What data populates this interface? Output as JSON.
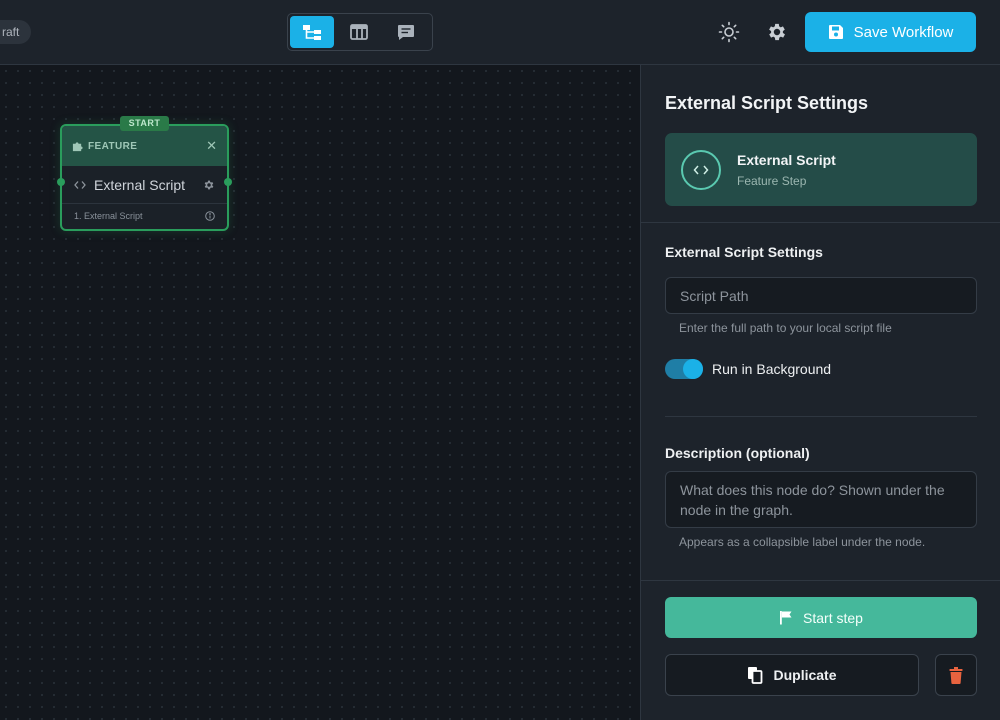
{
  "header": {
    "draft_badge": "raft",
    "view_buttons": [
      {
        "icon": "graph-view-icon",
        "active": true
      },
      {
        "icon": "table-view-icon",
        "active": false
      },
      {
        "icon": "comment-view-icon",
        "active": false
      }
    ],
    "theme_icon": "sun-icon",
    "settings_icon": "gear-icon",
    "save_label": "Save Workflow"
  },
  "canvas": {
    "node": {
      "start_tag": "START",
      "category": "FEATURE",
      "title": "External Script",
      "footer": "1. External Script"
    }
  },
  "panel": {
    "title": "External Script Settings",
    "node_card": {
      "name": "External Script",
      "subtitle": "Feature Step"
    },
    "settings_title": "External Script Settings",
    "script_path_placeholder": "Script Path",
    "script_path_hint": "Enter the full path to your local script file",
    "run_background_label": "Run in Background",
    "run_background_on": true,
    "description_title": "Description (optional)",
    "description_placeholder": "What does this node do? Shown under the node in the graph.",
    "description_hint": "Appears as a collapsible label under the node.",
    "start_step_label": "Start step",
    "duplicate_label": "Duplicate"
  },
  "colors": {
    "accent": "#1bb1e7",
    "start_green": "#45b89b",
    "danger": "#e8633f"
  }
}
